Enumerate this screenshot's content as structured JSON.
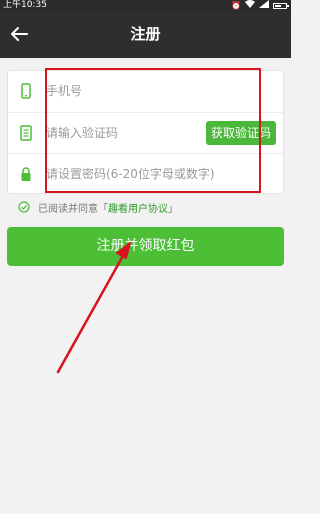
{
  "status_bar": {
    "time": "上午10:35"
  },
  "title_bar": {
    "title": "注册",
    "back_icon": "arrow-left-icon"
  },
  "form": {
    "phone": {
      "placeholder": "手机号",
      "icon": "phone-icon"
    },
    "code": {
      "placeholder": "请输入验证码",
      "icon": "sms-icon",
      "button_label": "获取验证码"
    },
    "password": {
      "placeholder": "请设置密码(6-20位字母或数字)",
      "icon": "lock-icon"
    }
  },
  "agreement": {
    "text": "已阅读并同意「",
    "link": "趣看用户协议",
    "text_end": "」"
  },
  "submit": {
    "label": "注册并领取红包"
  },
  "colors": {
    "accent_green": "#4cbf36",
    "title_bar": "#2e2e2e",
    "annotation_red": "#d9121f"
  }
}
